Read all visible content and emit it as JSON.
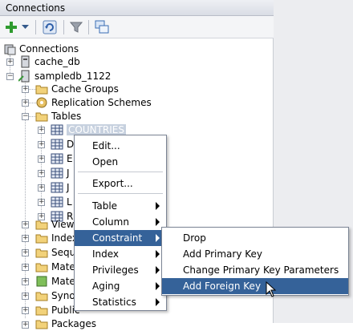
{
  "panel": {
    "title": "Connections"
  },
  "tree": {
    "root": "Connections",
    "cache_db": "cache_db",
    "sampledb": "sampledb_1122",
    "cache_groups": "Cache Groups",
    "replication": "Replication Schemes",
    "tables": "Tables",
    "countries": "COUNTRIES",
    "table_letters": [
      "D",
      "E",
      "J",
      "J",
      "L",
      "R"
    ],
    "views": "Views",
    "indexes": "Index",
    "sequences": "Sequ",
    "mat1": "Mate",
    "mat2": "Mate",
    "synonyms": "Syno",
    "public": "Public",
    "packages": "Packages"
  },
  "context_menu": {
    "edit": "Edit...",
    "open": "Open",
    "export": "Export...",
    "table": "Table",
    "column": "Column",
    "constraint": "Constraint",
    "index": "Index",
    "privileges": "Privileges",
    "aging": "Aging",
    "statistics": "Statistics"
  },
  "submenu": {
    "drop": "Drop",
    "add_pk": "Add Primary Key",
    "change_pk": "Change Primary Key Parameters",
    "add_fk": "Add Foreign Key"
  },
  "colors": {
    "highlight": "#356299",
    "selection": "#c7d1df",
    "add_icon": "#2f9b2f"
  }
}
